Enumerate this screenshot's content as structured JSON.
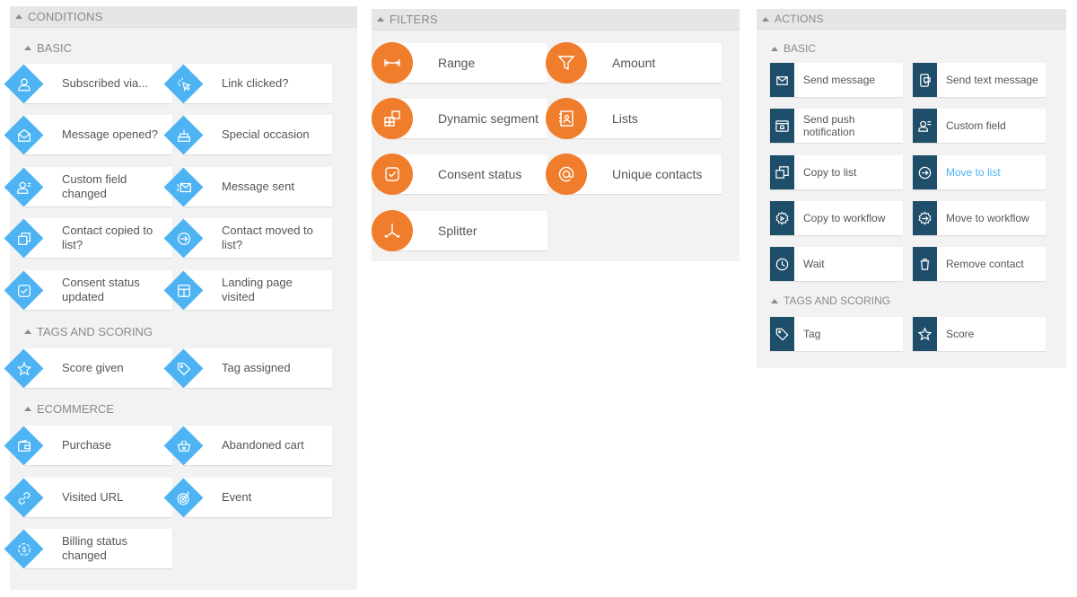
{
  "conditions": {
    "title": "CONDITIONS",
    "sections": {
      "basic": "BASIC",
      "tags": "TAGS AND SCORING",
      "ecommerce": "ECOMMERCE"
    },
    "basic_items": [
      {
        "label": "Subscribed via...",
        "icon": "user-icon"
      },
      {
        "label": "Link clicked?",
        "icon": "cursor-click-icon"
      },
      {
        "label": "Message opened?",
        "icon": "open-envelope-icon"
      },
      {
        "label": "Special occasion",
        "icon": "cake-icon"
      },
      {
        "label": "Custom field changed",
        "icon": "user-field-icon"
      },
      {
        "label": "Message sent",
        "icon": "envelope-sent-icon"
      },
      {
        "label": "Contact copied to list?",
        "icon": "copy-icon"
      },
      {
        "label": "Contact moved to list?",
        "icon": "move-circle-icon"
      },
      {
        "label": "Consent status updated",
        "icon": "checkbox-icon"
      },
      {
        "label": "Landing page visited",
        "icon": "layout-icon"
      }
    ],
    "tags_items": [
      {
        "label": "Score given",
        "icon": "star-icon"
      },
      {
        "label": "Tag assigned",
        "icon": "tag-icon"
      }
    ],
    "ecommerce_items": [
      {
        "label": "Purchase",
        "icon": "wallet-icon"
      },
      {
        "label": "Abandoned cart",
        "icon": "basket-icon"
      },
      {
        "label": "Visited URL",
        "icon": "link-icon"
      },
      {
        "label": "Event",
        "icon": "target-icon"
      },
      {
        "label": "Billing status changed",
        "icon": "billing-cycle-icon"
      }
    ]
  },
  "filters": {
    "title": "FILTERS",
    "items": [
      {
        "label": "Range",
        "icon": "range-icon"
      },
      {
        "label": "Amount",
        "icon": "funnel-icon"
      },
      {
        "label": "Dynamic segment",
        "icon": "segment-icon"
      },
      {
        "label": "Lists",
        "icon": "contact-book-icon"
      },
      {
        "label": "Consent status",
        "icon": "checkbox-icon"
      },
      {
        "label": "Unique contacts",
        "icon": "at-sign-icon"
      },
      {
        "label": "Splitter",
        "icon": "splitter-icon"
      }
    ]
  },
  "actions": {
    "title": "ACTIONS",
    "sections": {
      "basic": "BASIC",
      "tags": "TAGS AND SCORING"
    },
    "basic_items": [
      {
        "label": "Send message",
        "icon": "envelope-icon"
      },
      {
        "label": "Send text message",
        "icon": "phone-message-icon"
      },
      {
        "label": "Send push notification",
        "icon": "push-notification-icon"
      },
      {
        "label": "Custom field",
        "icon": "user-field-icon"
      },
      {
        "label": "Copy to list",
        "icon": "copy-icon"
      },
      {
        "label": "Move to list",
        "icon": "move-circle-icon",
        "highlighted": true
      },
      {
        "label": "Copy to workflow",
        "icon": "gear-play-icon"
      },
      {
        "label": "Move to workflow",
        "icon": "gear-arrow-icon"
      },
      {
        "label": "Wait",
        "icon": "clock-icon"
      },
      {
        "label": "Remove contact",
        "icon": "trash-icon"
      }
    ],
    "tags_items": [
      {
        "label": "Tag",
        "icon": "tag-icon"
      },
      {
        "label": "Score",
        "icon": "star-icon"
      }
    ]
  },
  "colors": {
    "condition_accent": "#4db3f3",
    "filter_accent": "#f07d2c",
    "action_accent": "#1e4e6a",
    "highlight_text": "#4db3f3"
  }
}
